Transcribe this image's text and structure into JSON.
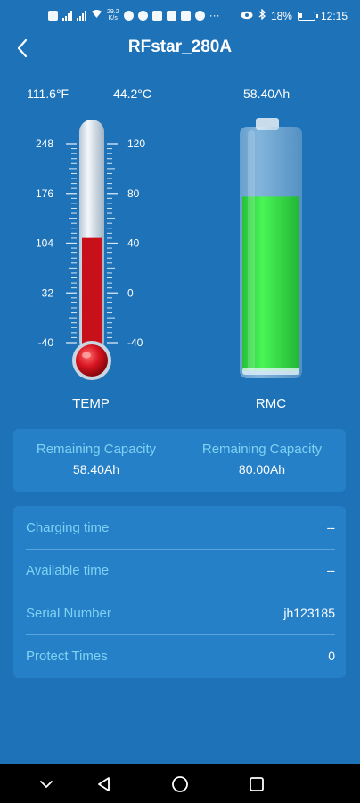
{
  "status_bar": {
    "net_speed_value": "29.2",
    "net_speed_unit": "K/s",
    "battery_percent": "18%",
    "time": "12:15"
  },
  "header": {
    "title": "RFstar_280A"
  },
  "temperature": {
    "fahrenheit": "111.6°F",
    "celsius": "44.2°C",
    "label": "TEMP",
    "f_ticks": [
      "248",
      "176",
      "104",
      "32",
      "-40"
    ],
    "c_ticks": [
      "120",
      "80",
      "40",
      "0",
      "-40"
    ],
    "celsius_value": 44.2,
    "scale_min_c": -40,
    "scale_max_c": 120,
    "liquid_color": "#c8101a"
  },
  "battery": {
    "value": "58.40Ah",
    "label": "RMC",
    "fill_fraction": 0.73,
    "fill_color": "#3ee84a"
  },
  "capacity_card": {
    "left_label": "Remaining Capacity",
    "left_value": "58.40Ah",
    "right_label": "Remaining Capacity",
    "right_value": "80.00Ah"
  },
  "info_rows": [
    {
      "label": "Charging time",
      "value": "--"
    },
    {
      "label": "Available time",
      "value": "--"
    },
    {
      "label": "Serial Number",
      "value": "jh123185"
    },
    {
      "label": "Protect Times",
      "value": "0"
    }
  ],
  "colors": {
    "background": "#1e73b8",
    "card": "#2580c8",
    "label_accent": "#7fd2f2"
  }
}
